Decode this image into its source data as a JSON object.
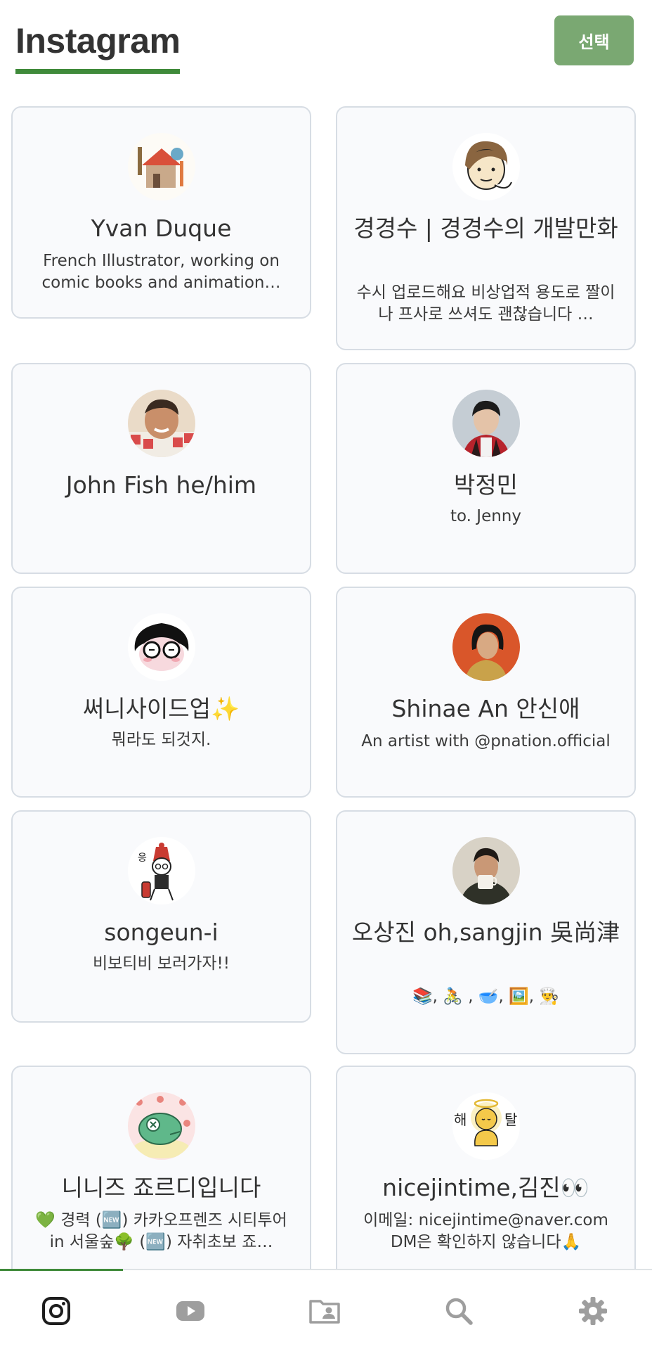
{
  "header": {
    "title": "Instagram",
    "select_label": "선택"
  },
  "accent_color": "#3f8a3a",
  "cards": [
    {
      "name": "Yvan Duque",
      "bio": "French Illustrator, working on comic books and animation…",
      "avatar": "illustration-avatar"
    },
    {
      "name": "경경수 | 경경수의 개발만화",
      "bio": "수시 업로드해요 비상업적 용도로 짤이나 프사로 쓰셔도 괜찮습니다 …",
      "avatar": "cartoon-face-avatar"
    },
    {
      "name": "John Fish he/him",
      "bio": "",
      "avatar": "photo-avatar"
    },
    {
      "name": "박정민",
      "bio": "to. Jenny",
      "avatar": "photo-avatar"
    },
    {
      "name": "써니사이드업✨",
      "bio": "뭐라도 되것지.",
      "avatar": "cartoon-glasses-avatar"
    },
    {
      "name": "Shinae An 안신애",
      "bio": "An artist with @pnation.official",
      "avatar": "photo-avatar"
    },
    {
      "name": "songeun-i",
      "bio": "비보티비 보러가자!!",
      "avatar": "cartoon-avatar"
    },
    {
      "name": "오상진 oh,sangjin 吳尚津",
      "bio": "📚, 🚴 , 🥣, 🖼️, 👨‍🍳",
      "avatar": "photo-avatar"
    },
    {
      "name": "니니즈 죠르디입니다",
      "bio": "💚 경력 (🆕) 카카오프렌즈 시티투어 in 서울숲🌳 (🆕) 자취초보 죠…",
      "avatar": "dinosaur-avatar"
    },
    {
      "name": "nicejintime,김진👀",
      "bio": "이메일: nicejintime@naver.com DM은 확인하지 않습니다🙏",
      "avatar": "cartoon-avatar"
    }
  ],
  "nav": [
    {
      "name": "instagram-icon"
    },
    {
      "name": "youtube-icon"
    },
    {
      "name": "folder-contact-icon"
    },
    {
      "name": "search-icon"
    },
    {
      "name": "gear-icon"
    }
  ]
}
